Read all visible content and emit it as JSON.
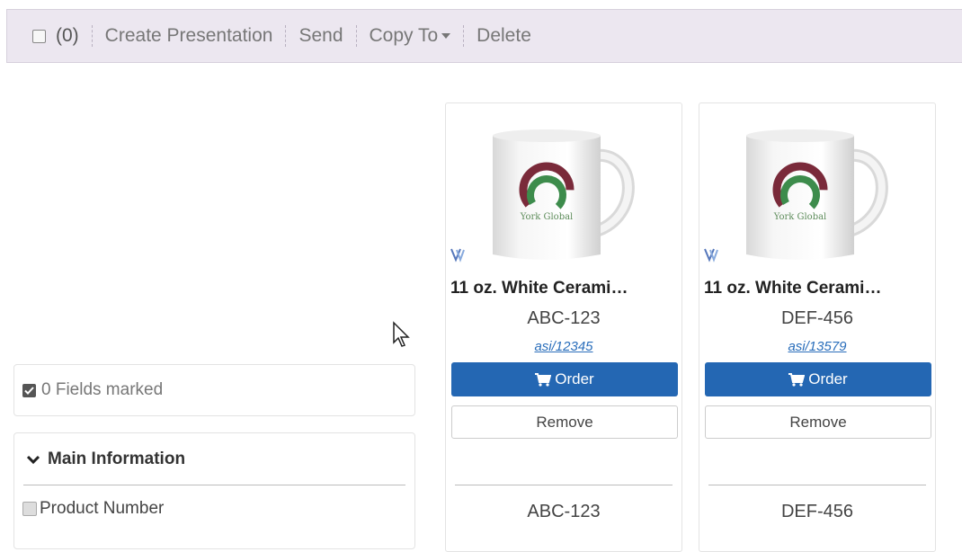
{
  "toolbar": {
    "count": "(0)",
    "create_presentation": "Create Presentation",
    "send": "Send",
    "copy_to": "Copy To",
    "delete": "Delete"
  },
  "fields_marked": "0 Fields marked",
  "section": {
    "title": "Main Information",
    "field_label": "Product Number"
  },
  "products": [
    {
      "title": "11 oz. White Cerami…",
      "number": "ABC-123",
      "asi": "asi/12345",
      "order_label": "Order",
      "remove_label": "Remove",
      "logo_text": "York Global"
    },
    {
      "title": "11 oz. White Cerami…",
      "number": "DEF-456",
      "asi": "asi/13579",
      "order_label": "Order",
      "remove_label": "Remove",
      "logo_text": "York Global"
    }
  ],
  "colors": {
    "toolbar_bg": "#ece7f0",
    "order_button": "#2467b3",
    "link": "#2a6ebb"
  }
}
